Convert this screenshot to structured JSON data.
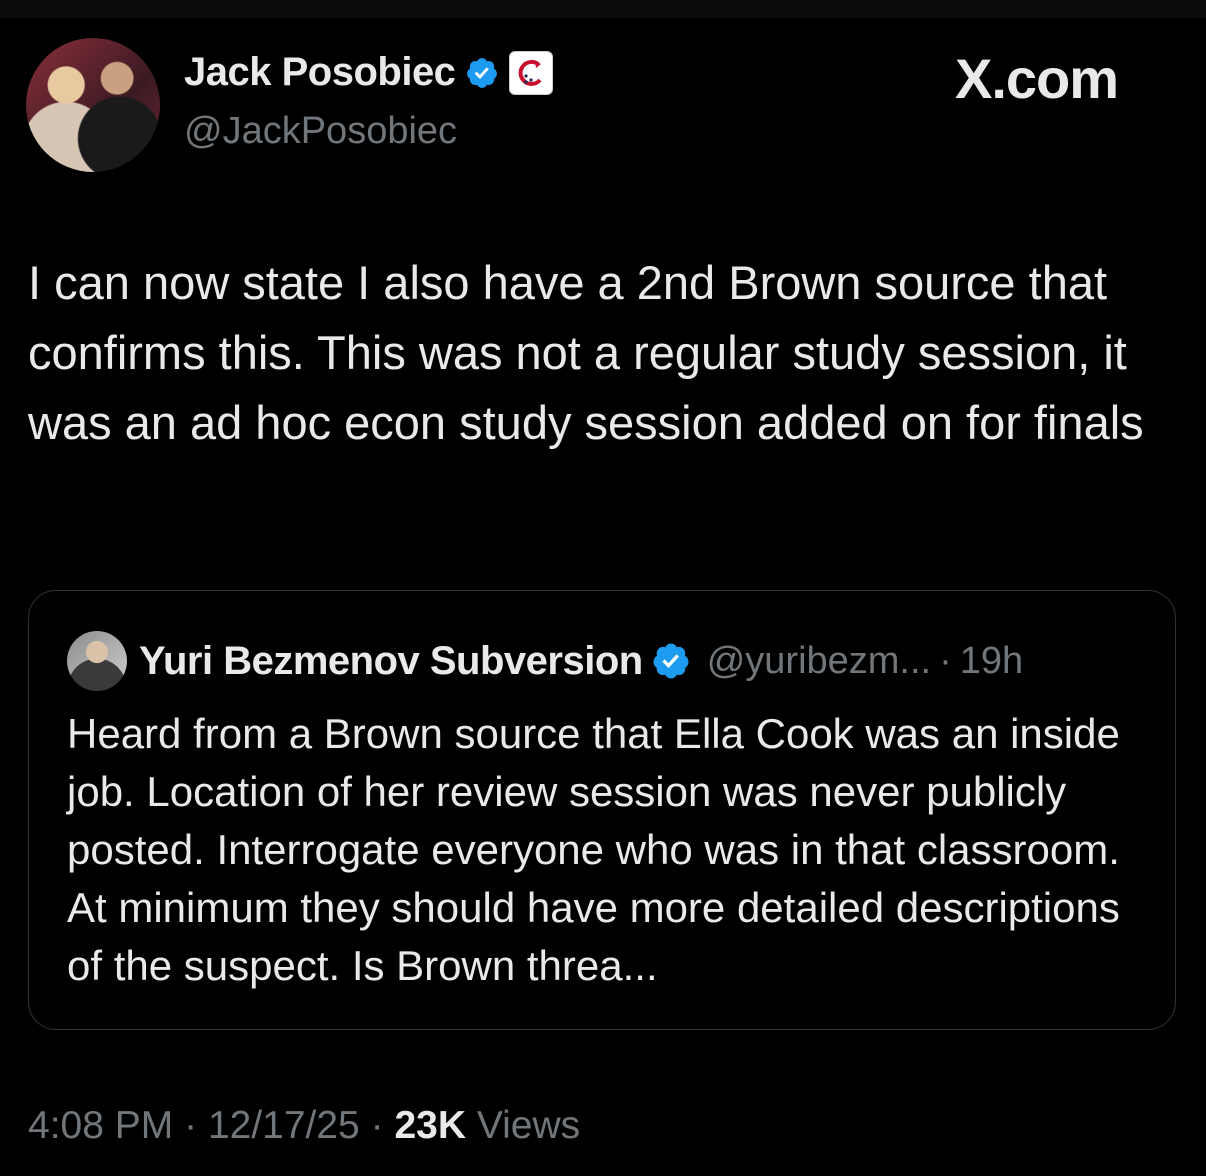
{
  "author": {
    "display_name": "Jack Posobiec",
    "handle": "@JackPosobiec",
    "verified_icon": "verified-badge-icon",
    "affiliation_icon": "affiliation-badge-icon"
  },
  "brand": {
    "label": "X.com"
  },
  "tweet": {
    "text": "I can now state I also have a 2nd Brown source that confirms this. This was not a regular study session, it was an ad hoc econ study session added on for finals"
  },
  "quote": {
    "display_name": "Yuri Bezmenov Subversion",
    "handle": "@yuribezm...",
    "separator": "·",
    "time": "19h",
    "text": "Heard from a Brown source that Ella Cook was an inside job. Location of her review session was never publicly posted. Interrogate everyone who was in that classroom. At minimum they should have more detailed descriptions of the suspect. Is Brown threa..."
  },
  "meta": {
    "time": "4:08 PM",
    "separator": "·",
    "date": "12/17/25",
    "views_count": "23K",
    "views_label": "Views"
  },
  "colors": {
    "background": "#000000",
    "text": "#e7e9ea",
    "secondary": "#71767b",
    "verified_blue": "#1d9bf0",
    "border": "#2f3336"
  }
}
